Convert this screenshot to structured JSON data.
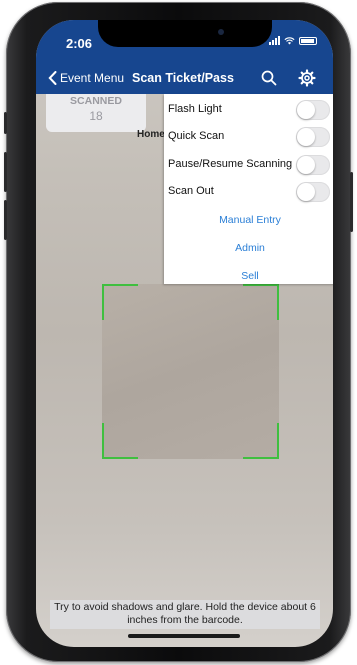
{
  "status_bar": {
    "time": "2:06"
  },
  "nav": {
    "back_label": "Event Menu",
    "title": "Scan Ticket/Pass",
    "search_icon": "search-icon",
    "settings_icon": "gear-icon"
  },
  "scanned": {
    "label": "SCANNED",
    "count": "18"
  },
  "home_label": "Home",
  "menu": {
    "toggles": [
      {
        "label": "Flash Light",
        "on": false
      },
      {
        "label": "Quick Scan",
        "on": false
      },
      {
        "label": "Pause/Resume Scanning",
        "on": false
      },
      {
        "label": "Scan Out",
        "on": false
      }
    ],
    "links": [
      "Manual Entry",
      "Admin",
      "Sell"
    ]
  },
  "hint": "Try to avoid shadows and glare. Hold the device about 6 inches from the barcode.",
  "colors": {
    "nav_bg": "#17468f",
    "link": "#2b7fd6",
    "scan_frame": "#3fbf3f"
  }
}
